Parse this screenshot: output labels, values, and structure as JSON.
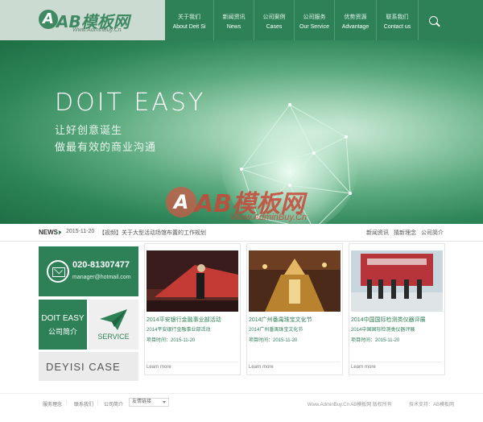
{
  "header": {
    "logo_mark": "A",
    "logo_text": "AB模板网",
    "logo_sub": "Www.AdminBuy.Cn",
    "nav": [
      {
        "cn": "关于我们",
        "en": "About Deit Si"
      },
      {
        "cn": "新闻资讯",
        "en": "News"
      },
      {
        "cn": "公司案例",
        "en": "Cases"
      },
      {
        "cn": "公司服务",
        "en": "Our Service"
      },
      {
        "cn": "优势资源",
        "en": "Advantage"
      },
      {
        "cn": "联系我们",
        "en": "Contact us"
      }
    ],
    "search_icon": "search-icon"
  },
  "banner": {
    "title": "DOIT EASY",
    "subtitle_1": "让好创意诞生",
    "subtitle_2": "做最有效的商业沟通"
  },
  "watermark": {
    "mark": "A",
    "text": "AB模板网",
    "sub": "Www.AdminBuy.Cn"
  },
  "newsbar": {
    "label": "NEWS:",
    "date": "2015-11-20",
    "headline": "【视频】关于大型活动场馆布置的工作规划",
    "links": [
      "新闻资讯",
      "猜新理念",
      "公司简介"
    ]
  },
  "contact": {
    "phone": "020-81307477",
    "email": "manager@hotmail.com",
    "icon": "mail-icon"
  },
  "about_tile": {
    "en": "DOIT EASY",
    "cn": "公司简介"
  },
  "service_tile": {
    "label": "SERVICE",
    "icon": "paper-plane-icon"
  },
  "case_tile": {
    "label": "DEYISI CASE",
    "icon": "arrow-right-icon"
  },
  "cards": [
    {
      "title": "2014平安银行金融事业部活动",
      "sub": "2014平安银行金融事业部活动",
      "date": "项目时间：2015-11-20",
      "more": "Learn more"
    },
    {
      "title": "2014广州番禺珠宝文化节",
      "sub": "2014广州番禺珠宝文化节",
      "date": "项目时间：2015-11-20",
      "more": "Learn more"
    },
    {
      "title": "2014中国国际检测类仪器评展",
      "sub": "2014中国国际检测类仪器评展",
      "date": "项目时间：2015-11-20",
      "more": "Learn more"
    }
  ],
  "footer": {
    "links": [
      "服务理念",
      "联系我们",
      "公司简介"
    ],
    "select": "友情链接",
    "right": [
      "Www.AdminBuy.Cn AB模板网 版权所有",
      "技术支持：AB模板网"
    ]
  },
  "colors": {
    "brand_green": "#2e8156",
    "logo_bg": "#cbdbd2",
    "watermark_red": "#c84637"
  }
}
